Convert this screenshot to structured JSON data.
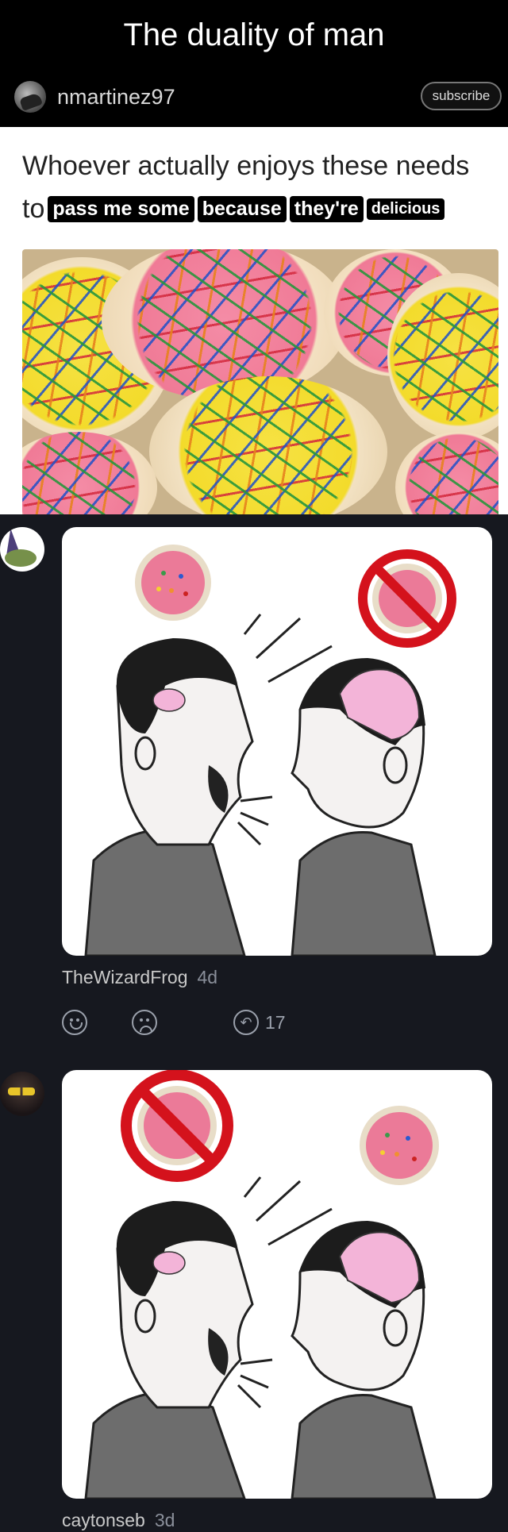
{
  "header": {
    "title": "The duality of man",
    "username": "nmartinez97",
    "subscribe_label": "subscribe"
  },
  "meme": {
    "line1": "Whoever actually enjoys these needs",
    "line2_prefix": "to",
    "highlight_1": "pass me some",
    "highlight_2": "because",
    "highlight_3": "they're",
    "highlight_4": "delicious"
  },
  "comments": [
    {
      "username": "TheWizardFrog",
      "age": "4d",
      "reply_count": "17"
    },
    {
      "username": "caytonseb",
      "age": "3d"
    }
  ],
  "icons": {
    "upvote": "smile-icon",
    "downvote": "frown-icon",
    "reply": "reply-icon"
  },
  "colors": {
    "background": "#16181f",
    "header_bg": "#000000",
    "no_sign_red": "#d4121c",
    "brain_pink": "#f3b4d8"
  }
}
